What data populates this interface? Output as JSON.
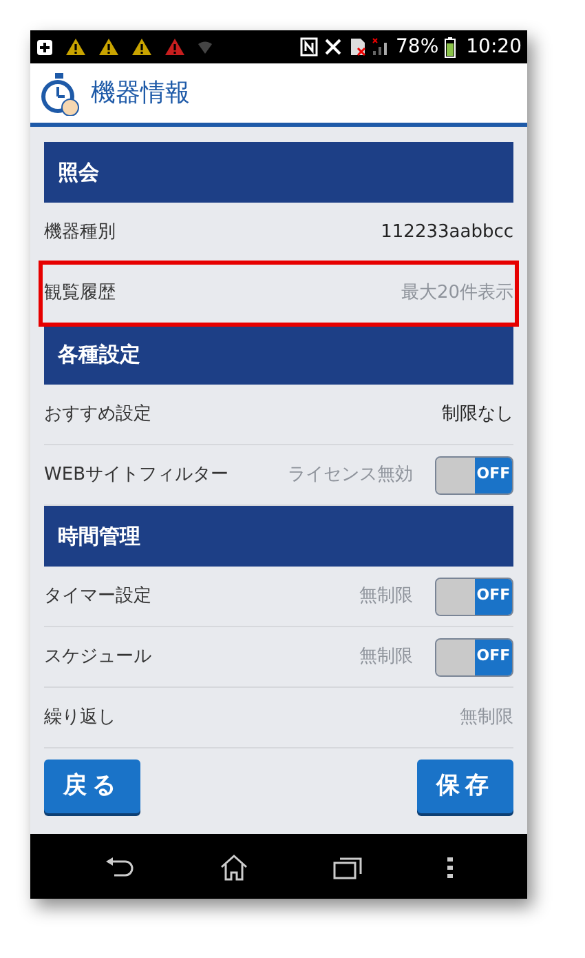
{
  "status_bar": {
    "battery": "78%",
    "time": "10:20"
  },
  "header": {
    "title": "機器情報"
  },
  "items": [
    {
      "kind": "section",
      "label": "照会"
    },
    {
      "kind": "row",
      "label": "機器種別",
      "value": "112233aabbcc",
      "dimmed": false,
      "highlighted": false
    },
    {
      "kind": "row",
      "label": "観覧履歴",
      "value": "最大20件表示",
      "dimmed": true,
      "highlighted": true
    },
    {
      "kind": "section",
      "label": "各種設定"
    },
    {
      "kind": "row",
      "label": "おすすめ設定",
      "value": "制限なし",
      "dimmed": false,
      "highlighted": false
    },
    {
      "kind": "toggle",
      "label": "WEBサイトフィルター",
      "value": "ライセンス無効",
      "dimmed": true,
      "highlighted": false,
      "on": false,
      "state_label": "OFF"
    },
    {
      "kind": "section",
      "label": "時間管理"
    },
    {
      "kind": "toggle",
      "label": "タイマー設定",
      "value": "無制限",
      "dimmed": true,
      "highlighted": false,
      "on": false,
      "state_label": "OFF"
    },
    {
      "kind": "toggle",
      "label": "スケジュール",
      "value": "無制限",
      "dimmed": true,
      "highlighted": false,
      "on": false,
      "state_label": "OFF"
    },
    {
      "kind": "row",
      "label": "繰り返し",
      "value": "無制限",
      "dimmed": true,
      "highlighted": false
    }
  ],
  "buttons": {
    "back": "戻る",
    "save": "保存"
  }
}
